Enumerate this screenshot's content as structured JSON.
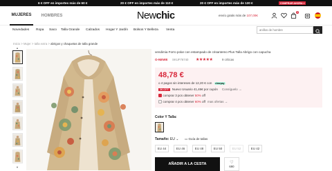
{
  "promo": {
    "offers": [
      "6 € OFF en importes más de 60 €",
      "20 € OFF en importes más de 110 €",
      "20 € OFF en importes más de 130 €"
    ],
    "button": "COMPRAR AHORA »"
  },
  "header": {
    "tabs": [
      "MUJERES",
      "HOMBRES"
    ],
    "logo_a": "New",
    "logo_b": "chic",
    "shipping_prefix": "envío gratis más de ",
    "shipping_amount": "107,00€",
    "bag_count": "0",
    "icons": [
      "user-icon",
      "heart-icon",
      "bag-icon",
      "spain-flag-icon"
    ]
  },
  "nav": {
    "items": [
      "Novedades",
      "Ropa",
      "Saco",
      "Talla Grande",
      "Calzados",
      "Hogar Y Jardín",
      "Bolsos Y Belleza",
      "Venta"
    ],
    "search_placeholder": "anillos de hombre"
  },
  "breadcrumb": {
    "items": [
      "Inicio",
      "Mujer",
      "talla extra"
    ],
    "current": "abrigos y chaquetas de talla grande",
    "separator": "  >  "
  },
  "product": {
    "title": "vendimia Forro polar con estampado de crisantemo Plus Talla Abrigo con capucha",
    "brand": "O-NEWE",
    "sku": "SKUF76740",
    "rating": 5,
    "stars": "★★★★★",
    "reviews": "9 críticas",
    "price": "48,78 €",
    "installments_prefix": "o 4 pagos sin intereses de ",
    "installment_amount": "12,20 €",
    "installments_with": " con ",
    "clearpay": "clearpay",
    "coupon_chip": "3€ OFF",
    "coupon_text": "Nuevo Usuario 41,46€ por cupón",
    "coupon_link": "Consíguelo →",
    "offer1_prefix": "comprar 3 pcs obtener ",
    "offer1_pct": "50%",
    "offer1_suffix": " off",
    "offer2_prefix": "comprar 4 pcs obtener ",
    "offer2_pct": "60%",
    "offer2_suffix": " off",
    "more_offers": "mas ofertas →",
    "color_label": "Color Y Talla:",
    "size_label": "Tamaño:",
    "size_system": "EU",
    "size_guide": "Guía de tallas",
    "sizes": [
      {
        "label": "EU 44",
        "available": true
      },
      {
        "label": "EU 46",
        "available": true
      },
      {
        "label": "EU 48",
        "available": true
      },
      {
        "label": "EU 50",
        "available": true
      },
      {
        "label": "EU 52",
        "available": false
      },
      {
        "label": "EU 42",
        "available": true
      }
    ],
    "add_to_cart": "AÑADIR A LA CESTA",
    "wishlist_count": "690"
  },
  "colors": {
    "accent": "#d8283b",
    "dark": "#111111",
    "price_bg": "#fdf1f2"
  }
}
